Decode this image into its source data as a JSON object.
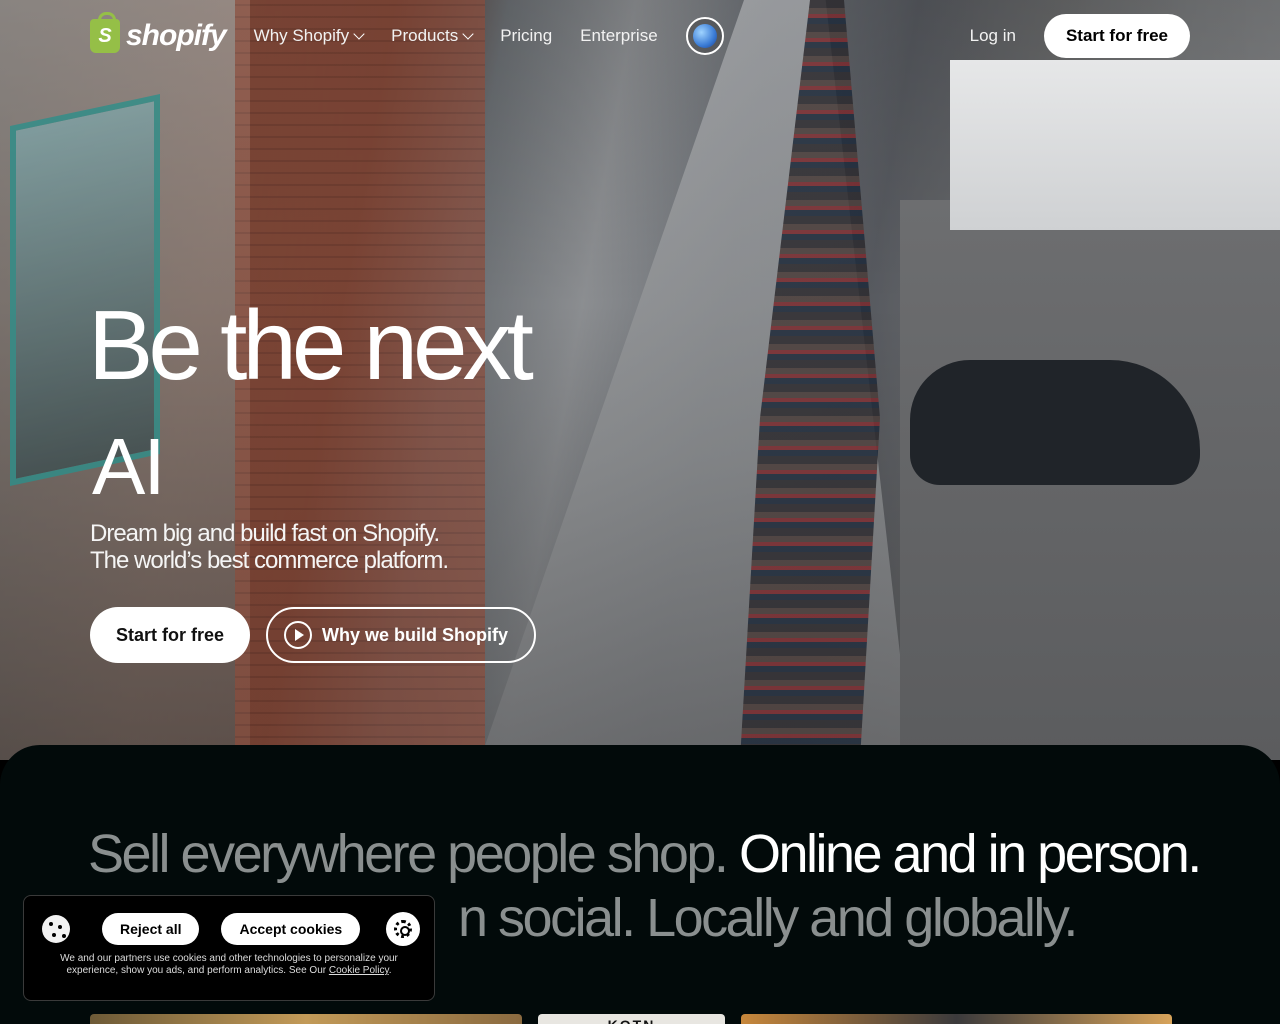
{
  "header": {
    "logo_text": "shopify",
    "nav": [
      {
        "label": "Why Shopify",
        "has_dropdown": true
      },
      {
        "label": "Products",
        "has_dropdown": true
      },
      {
        "label": "Pricing",
        "has_dropdown": false
      },
      {
        "label": "Enterprise",
        "has_dropdown": false
      }
    ],
    "login": "Log in",
    "start": "Start for free"
  },
  "hero": {
    "title": "Be the next",
    "rotating_word": "AI",
    "subtitle_line1": "Dream big and build fast on Shopify.",
    "subtitle_line2": "The world’s best commerce platform.",
    "cta_primary": "Start for free",
    "cta_secondary": "Why we build Shopify"
  },
  "sell": {
    "part1": "Sell everywhere people shop.",
    "part2": "Online and in person.",
    "part3": "n social. Locally and globally."
  },
  "thumbs": {
    "t2_text": "KOTN"
  },
  "cookie": {
    "reject": "Reject all",
    "accept": "Accept cookies",
    "text": "We and our partners use cookies and other technologies to personalize your experience, show you ads, and perform analytics. See Our",
    "link": "Cookie Policy",
    "period": "."
  },
  "colors": {
    "brand_green": "#95bf47",
    "dark_bg": "#020a0a",
    "muted_text": "#8a8f8f"
  }
}
